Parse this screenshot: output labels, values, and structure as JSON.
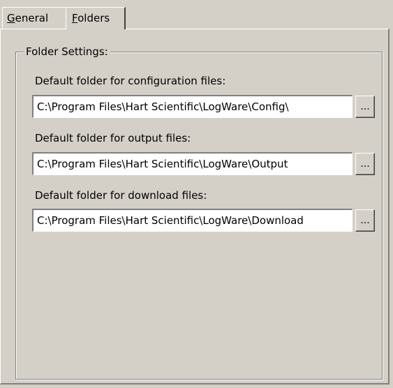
{
  "tabs": {
    "general": {
      "mnemonic": "G",
      "rest": "eneral"
    },
    "folders": {
      "mnemonic": "F",
      "rest": "olders"
    }
  },
  "group": {
    "legend": "Folder Settings:"
  },
  "fields": {
    "config": {
      "label": "Default folder for configuration files:",
      "value": "C:\\Program Files\\Hart Scientific\\LogWare\\Config\\",
      "browse_label": "..."
    },
    "output": {
      "label": "Default folder for output files:",
      "value": "C:\\Program Files\\Hart Scientific\\LogWare\\Output",
      "browse_label": "..."
    },
    "download": {
      "label": "Default folder for download files:",
      "value": "C:\\Program Files\\Hart Scientific\\LogWare\\Download",
      "browse_label": "..."
    }
  },
  "colors": {
    "face": "#d4d0c8",
    "highlight": "#ffffff",
    "shadow": "#808080",
    "dark_shadow": "#404040"
  }
}
